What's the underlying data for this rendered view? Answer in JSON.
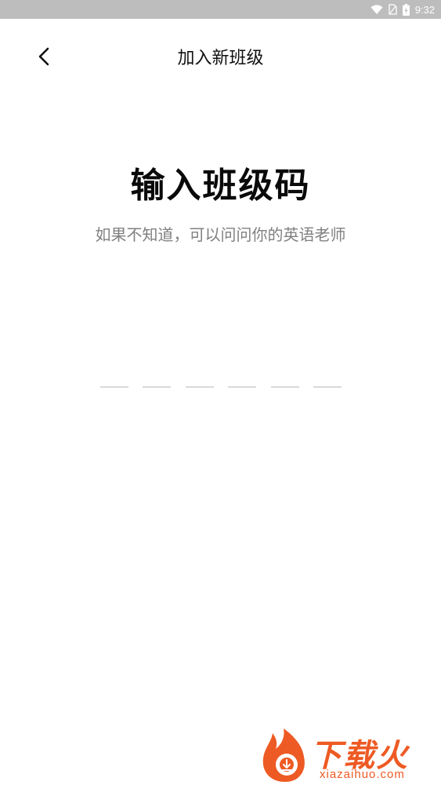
{
  "status_bar": {
    "time": "9:32",
    "icons": [
      "wifi-icon",
      "no-sim-icon",
      "battery-icon"
    ]
  },
  "nav": {
    "back_icon": "chevron-left-icon",
    "title": "加入新班级"
  },
  "main": {
    "heading": "输入班级码",
    "subtitle": "如果不知道，可以问问你的英语老师",
    "code_length": 6
  },
  "watermark": {
    "brand": "下载火",
    "domain": "xiazaihuo.com"
  },
  "colors": {
    "status_bar_bg": "#bdbdbd",
    "watermark": "#ee5a24",
    "subtitle": "#808080",
    "code_underline": "#d9d9d9"
  }
}
